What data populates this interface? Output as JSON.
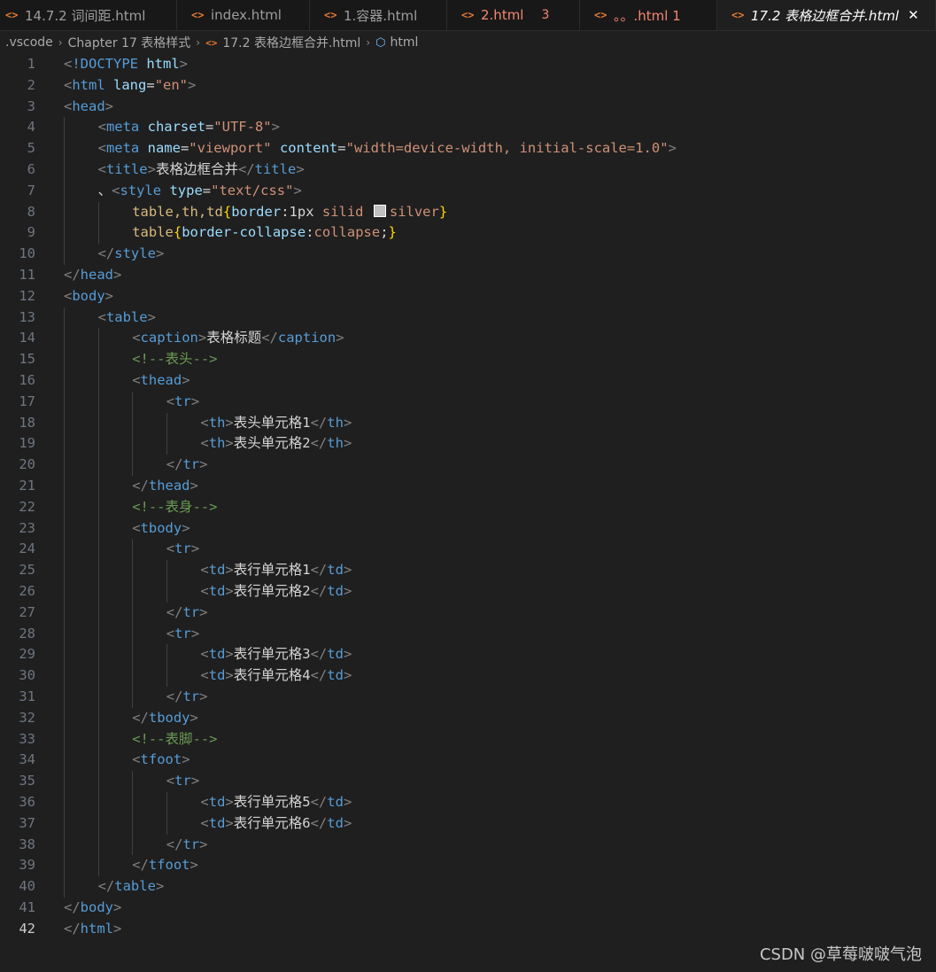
{
  "tabs": [
    {
      "icon": "<>",
      "label": "14.7.2 词间距.html",
      "state": "normal"
    },
    {
      "icon": "<>",
      "label": "index.html",
      "state": "normal"
    },
    {
      "icon": "<>",
      "label": "1.容器.html",
      "state": "normal"
    },
    {
      "icon": "<>",
      "label": "2.html",
      "state": "error",
      "badge": "3"
    },
    {
      "icon": "<>",
      "label": "。。.html 1",
      "state": "error"
    },
    {
      "icon": "<>",
      "label": "17.2 表格边框合并.html",
      "state": "active",
      "close": "✕"
    }
  ],
  "breadcrumb": {
    "items": [
      ".vscode",
      "Chapter 17 表格样式",
      "17.2 表格边框合并.html",
      "html"
    ],
    "separator": "›",
    "file_icon": "<>",
    "symbol_icon": "⬡"
  },
  "current_line": 42,
  "colors": {
    "background": "#1f1f1f",
    "tag": "#569cd6",
    "attribute": "#9cdcfe",
    "string": "#ce9178",
    "comment": "#6a9955",
    "selector": "#d7ba7d",
    "swatch": "#c0c0c0"
  },
  "lines": [
    {
      "n": 1,
      "indent": 0,
      "tokens": [
        [
          "brk",
          "<"
        ],
        [
          "tag",
          "!DOCTYPE "
        ],
        [
          "attr",
          "html"
        ],
        [
          "brk",
          ">"
        ]
      ]
    },
    {
      "n": 2,
      "indent": 0,
      "tokens": [
        [
          "brk",
          "<"
        ],
        [
          "tag",
          "html "
        ],
        [
          "attr",
          "lang"
        ],
        [
          "text",
          "="
        ],
        [
          "str",
          "\"en\""
        ],
        [
          "brk",
          ">"
        ]
      ]
    },
    {
      "n": 3,
      "indent": 0,
      "tokens": [
        [
          "brk",
          "<"
        ],
        [
          "tag",
          "head"
        ],
        [
          "brk",
          ">"
        ]
      ]
    },
    {
      "n": 4,
      "indent": 1,
      "tokens": [
        [
          "brk",
          "<"
        ],
        [
          "tag",
          "meta "
        ],
        [
          "attr",
          "charset"
        ],
        [
          "text",
          "="
        ],
        [
          "str",
          "\"UTF-8\""
        ],
        [
          "brk",
          ">"
        ]
      ]
    },
    {
      "n": 5,
      "indent": 1,
      "tokens": [
        [
          "brk",
          "<"
        ],
        [
          "tag",
          "meta "
        ],
        [
          "attr",
          "name"
        ],
        [
          "text",
          "="
        ],
        [
          "str",
          "\"viewport\" "
        ],
        [
          "attr",
          "content"
        ],
        [
          "text",
          "="
        ],
        [
          "str",
          "\"width=device-width, initial-scale=1.0\""
        ],
        [
          "brk",
          ">"
        ]
      ]
    },
    {
      "n": 6,
      "indent": 1,
      "tokens": [
        [
          "brk",
          "<"
        ],
        [
          "tag",
          "title"
        ],
        [
          "brk",
          ">"
        ],
        [
          "text",
          "表格边框合并"
        ],
        [
          "brk",
          "</"
        ],
        [
          "tag",
          "title"
        ],
        [
          "brk",
          ">"
        ]
      ]
    },
    {
      "n": 7,
      "indent": 1,
      "tokens": [
        [
          "text",
          "、"
        ],
        [
          "brk",
          "<"
        ],
        [
          "tag",
          "style "
        ],
        [
          "attr",
          "type"
        ],
        [
          "text",
          "="
        ],
        [
          "str",
          "\"text/css\""
        ],
        [
          "brk",
          ">"
        ]
      ]
    },
    {
      "n": 8,
      "indent": 2,
      "tokens": [
        [
          "sel",
          "table,th,td"
        ],
        [
          "brace",
          "{"
        ],
        [
          "prop",
          "border"
        ],
        [
          "text",
          ":"
        ],
        [
          "num",
          "1px "
        ],
        [
          "val",
          "silid "
        ],
        [
          "swatch",
          ""
        ],
        [
          "val",
          "silver"
        ],
        [
          "brace",
          "}"
        ]
      ]
    },
    {
      "n": 9,
      "indent": 2,
      "tokens": [
        [
          "sel",
          "table"
        ],
        [
          "brace",
          "{"
        ],
        [
          "prop",
          "border-collapse"
        ],
        [
          "text",
          ":"
        ],
        [
          "val",
          "collapse"
        ],
        [
          "text",
          ";"
        ],
        [
          "brace",
          "}"
        ]
      ]
    },
    {
      "n": 10,
      "indent": 1,
      "tokens": [
        [
          "brk",
          "</"
        ],
        [
          "tag",
          "style"
        ],
        [
          "brk",
          ">"
        ]
      ]
    },
    {
      "n": 11,
      "indent": 0,
      "tokens": [
        [
          "brk",
          "</"
        ],
        [
          "tag",
          "head"
        ],
        [
          "brk",
          ">"
        ]
      ]
    },
    {
      "n": 12,
      "indent": 0,
      "tokens": [
        [
          "brk",
          "<"
        ],
        [
          "tag",
          "body"
        ],
        [
          "brk",
          ">"
        ]
      ]
    },
    {
      "n": 13,
      "indent": 1,
      "tokens": [
        [
          "brk",
          "<"
        ],
        [
          "tag",
          "table"
        ],
        [
          "brk",
          ">"
        ]
      ]
    },
    {
      "n": 14,
      "indent": 2,
      "tokens": [
        [
          "brk",
          "<"
        ],
        [
          "tag",
          "caption"
        ],
        [
          "brk",
          ">"
        ],
        [
          "text",
          "表格标题"
        ],
        [
          "brk",
          "</"
        ],
        [
          "tag",
          "caption"
        ],
        [
          "brk",
          ">"
        ]
      ]
    },
    {
      "n": 15,
      "indent": 2,
      "tokens": [
        [
          "com",
          "<!--表头-->"
        ]
      ]
    },
    {
      "n": 16,
      "indent": 2,
      "tokens": [
        [
          "brk",
          "<"
        ],
        [
          "tag",
          "thead"
        ],
        [
          "brk",
          ">"
        ]
      ]
    },
    {
      "n": 17,
      "indent": 3,
      "tokens": [
        [
          "brk",
          "<"
        ],
        [
          "tag",
          "tr"
        ],
        [
          "brk",
          ">"
        ]
      ]
    },
    {
      "n": 18,
      "indent": 4,
      "tokens": [
        [
          "brk",
          "<"
        ],
        [
          "tag",
          "th"
        ],
        [
          "brk",
          ">"
        ],
        [
          "text",
          "表头单元格1"
        ],
        [
          "brk",
          "</"
        ],
        [
          "tag",
          "th"
        ],
        [
          "brk",
          ">"
        ]
      ]
    },
    {
      "n": 19,
      "indent": 4,
      "tokens": [
        [
          "brk",
          "<"
        ],
        [
          "tag",
          "th"
        ],
        [
          "brk",
          ">"
        ],
        [
          "text",
          "表头单元格2"
        ],
        [
          "brk",
          "</"
        ],
        [
          "tag",
          "th"
        ],
        [
          "brk",
          ">"
        ]
      ]
    },
    {
      "n": 20,
      "indent": 3,
      "tokens": [
        [
          "brk",
          "</"
        ],
        [
          "tag",
          "tr"
        ],
        [
          "brk",
          ">"
        ]
      ]
    },
    {
      "n": 21,
      "indent": 2,
      "tokens": [
        [
          "brk",
          "</"
        ],
        [
          "tag",
          "thead"
        ],
        [
          "brk",
          ">"
        ]
      ]
    },
    {
      "n": 22,
      "indent": 2,
      "tokens": [
        [
          "com",
          "<!--表身-->"
        ]
      ]
    },
    {
      "n": 23,
      "indent": 2,
      "tokens": [
        [
          "brk",
          "<"
        ],
        [
          "tag",
          "tbody"
        ],
        [
          "brk",
          ">"
        ]
      ]
    },
    {
      "n": 24,
      "indent": 3,
      "tokens": [
        [
          "brk",
          "<"
        ],
        [
          "tag",
          "tr"
        ],
        [
          "brk",
          ">"
        ]
      ]
    },
    {
      "n": 25,
      "indent": 4,
      "tokens": [
        [
          "brk",
          "<"
        ],
        [
          "tag",
          "td"
        ],
        [
          "brk",
          ">"
        ],
        [
          "text",
          "表行单元格1"
        ],
        [
          "brk",
          "</"
        ],
        [
          "tag",
          "td"
        ],
        [
          "brk",
          ">"
        ]
      ]
    },
    {
      "n": 26,
      "indent": 4,
      "tokens": [
        [
          "brk",
          "<"
        ],
        [
          "tag",
          "td"
        ],
        [
          "brk",
          ">"
        ],
        [
          "text",
          "表行单元格2"
        ],
        [
          "brk",
          "</"
        ],
        [
          "tag",
          "td"
        ],
        [
          "brk",
          ">"
        ]
      ]
    },
    {
      "n": 27,
      "indent": 3,
      "tokens": [
        [
          "brk",
          "</"
        ],
        [
          "tag",
          "tr"
        ],
        [
          "brk",
          ">"
        ]
      ]
    },
    {
      "n": 28,
      "indent": 3,
      "tokens": [
        [
          "brk",
          "<"
        ],
        [
          "tag",
          "tr"
        ],
        [
          "brk",
          ">"
        ]
      ]
    },
    {
      "n": 29,
      "indent": 4,
      "tokens": [
        [
          "brk",
          "<"
        ],
        [
          "tag",
          "td"
        ],
        [
          "brk",
          ">"
        ],
        [
          "text",
          "表行单元格3"
        ],
        [
          "brk",
          "</"
        ],
        [
          "tag",
          "td"
        ],
        [
          "brk",
          ">"
        ]
      ]
    },
    {
      "n": 30,
      "indent": 4,
      "tokens": [
        [
          "brk",
          "<"
        ],
        [
          "tag",
          "td"
        ],
        [
          "brk",
          ">"
        ],
        [
          "text",
          "表行单元格4"
        ],
        [
          "brk",
          "</"
        ],
        [
          "tag",
          "td"
        ],
        [
          "brk",
          ">"
        ]
      ]
    },
    {
      "n": 31,
      "indent": 3,
      "tokens": [
        [
          "brk",
          "</"
        ],
        [
          "tag",
          "tr"
        ],
        [
          "brk",
          ">"
        ]
      ]
    },
    {
      "n": 32,
      "indent": 2,
      "tokens": [
        [
          "brk",
          "</"
        ],
        [
          "tag",
          "tbody"
        ],
        [
          "brk",
          ">"
        ]
      ]
    },
    {
      "n": 33,
      "indent": 2,
      "tokens": [
        [
          "com",
          "<!--表脚-->"
        ]
      ]
    },
    {
      "n": 34,
      "indent": 2,
      "tokens": [
        [
          "brk",
          "<"
        ],
        [
          "tag",
          "tfoot"
        ],
        [
          "brk",
          ">"
        ]
      ]
    },
    {
      "n": 35,
      "indent": 3,
      "tokens": [
        [
          "brk",
          "<"
        ],
        [
          "tag",
          "tr"
        ],
        [
          "brk",
          ">"
        ]
      ]
    },
    {
      "n": 36,
      "indent": 4,
      "tokens": [
        [
          "brk",
          "<"
        ],
        [
          "tag",
          "td"
        ],
        [
          "brk",
          ">"
        ],
        [
          "text",
          "表行单元格5"
        ],
        [
          "brk",
          "</"
        ],
        [
          "tag",
          "td"
        ],
        [
          "brk",
          ">"
        ]
      ]
    },
    {
      "n": 37,
      "indent": 4,
      "tokens": [
        [
          "brk",
          "<"
        ],
        [
          "tag",
          "td"
        ],
        [
          "brk",
          ">"
        ],
        [
          "text",
          "表行单元格6"
        ],
        [
          "brk",
          "</"
        ],
        [
          "tag",
          "td"
        ],
        [
          "brk",
          ">"
        ]
      ]
    },
    {
      "n": 38,
      "indent": 3,
      "tokens": [
        [
          "brk",
          "</"
        ],
        [
          "tag",
          "tr"
        ],
        [
          "brk",
          ">"
        ]
      ]
    },
    {
      "n": 39,
      "indent": 2,
      "tokens": [
        [
          "brk",
          "</"
        ],
        [
          "tag",
          "tfoot"
        ],
        [
          "brk",
          ">"
        ]
      ]
    },
    {
      "n": 40,
      "indent": 1,
      "tokens": [
        [
          "brk",
          "</"
        ],
        [
          "tag",
          "table"
        ],
        [
          "brk",
          ">"
        ]
      ]
    },
    {
      "n": 41,
      "indent": 0,
      "tokens": [
        [
          "brk",
          "</"
        ],
        [
          "tag",
          "body"
        ],
        [
          "brk",
          ">"
        ]
      ]
    },
    {
      "n": 42,
      "indent": 0,
      "tokens": [
        [
          "brk",
          "</"
        ],
        [
          "tag",
          "html"
        ],
        [
          "brk",
          ">"
        ]
      ]
    }
  ],
  "watermark": "CSDN @草莓啵啵气泡"
}
